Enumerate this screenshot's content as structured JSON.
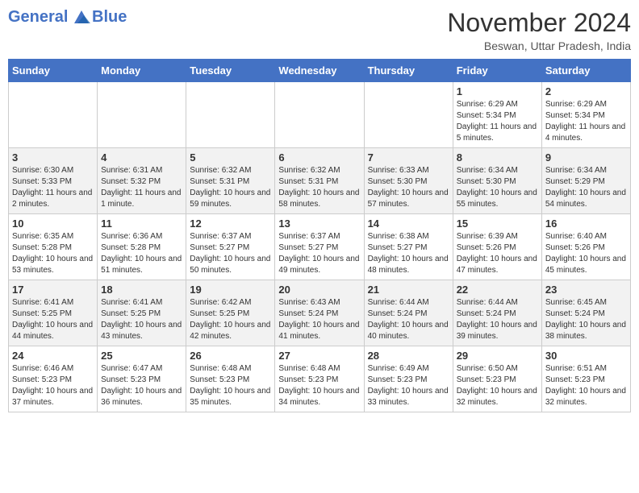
{
  "header": {
    "logo_line1": "General",
    "logo_line2": "Blue",
    "month": "November 2024",
    "location": "Beswan, Uttar Pradesh, India"
  },
  "days_of_week": [
    "Sunday",
    "Monday",
    "Tuesday",
    "Wednesday",
    "Thursday",
    "Friday",
    "Saturday"
  ],
  "weeks": [
    [
      {
        "day": "",
        "info": ""
      },
      {
        "day": "",
        "info": ""
      },
      {
        "day": "",
        "info": ""
      },
      {
        "day": "",
        "info": ""
      },
      {
        "day": "",
        "info": ""
      },
      {
        "day": "1",
        "info": "Sunrise: 6:29 AM\nSunset: 5:34 PM\nDaylight: 11 hours and 5 minutes."
      },
      {
        "day": "2",
        "info": "Sunrise: 6:29 AM\nSunset: 5:34 PM\nDaylight: 11 hours and 4 minutes."
      }
    ],
    [
      {
        "day": "3",
        "info": "Sunrise: 6:30 AM\nSunset: 5:33 PM\nDaylight: 11 hours and 2 minutes."
      },
      {
        "day": "4",
        "info": "Sunrise: 6:31 AM\nSunset: 5:32 PM\nDaylight: 11 hours and 1 minute."
      },
      {
        "day": "5",
        "info": "Sunrise: 6:32 AM\nSunset: 5:31 PM\nDaylight: 10 hours and 59 minutes."
      },
      {
        "day": "6",
        "info": "Sunrise: 6:32 AM\nSunset: 5:31 PM\nDaylight: 10 hours and 58 minutes."
      },
      {
        "day": "7",
        "info": "Sunrise: 6:33 AM\nSunset: 5:30 PM\nDaylight: 10 hours and 57 minutes."
      },
      {
        "day": "8",
        "info": "Sunrise: 6:34 AM\nSunset: 5:30 PM\nDaylight: 10 hours and 55 minutes."
      },
      {
        "day": "9",
        "info": "Sunrise: 6:34 AM\nSunset: 5:29 PM\nDaylight: 10 hours and 54 minutes."
      }
    ],
    [
      {
        "day": "10",
        "info": "Sunrise: 6:35 AM\nSunset: 5:28 PM\nDaylight: 10 hours and 53 minutes."
      },
      {
        "day": "11",
        "info": "Sunrise: 6:36 AM\nSunset: 5:28 PM\nDaylight: 10 hours and 51 minutes."
      },
      {
        "day": "12",
        "info": "Sunrise: 6:37 AM\nSunset: 5:27 PM\nDaylight: 10 hours and 50 minutes."
      },
      {
        "day": "13",
        "info": "Sunrise: 6:37 AM\nSunset: 5:27 PM\nDaylight: 10 hours and 49 minutes."
      },
      {
        "day": "14",
        "info": "Sunrise: 6:38 AM\nSunset: 5:27 PM\nDaylight: 10 hours and 48 minutes."
      },
      {
        "day": "15",
        "info": "Sunrise: 6:39 AM\nSunset: 5:26 PM\nDaylight: 10 hours and 47 minutes."
      },
      {
        "day": "16",
        "info": "Sunrise: 6:40 AM\nSunset: 5:26 PM\nDaylight: 10 hours and 45 minutes."
      }
    ],
    [
      {
        "day": "17",
        "info": "Sunrise: 6:41 AM\nSunset: 5:25 PM\nDaylight: 10 hours and 44 minutes."
      },
      {
        "day": "18",
        "info": "Sunrise: 6:41 AM\nSunset: 5:25 PM\nDaylight: 10 hours and 43 minutes."
      },
      {
        "day": "19",
        "info": "Sunrise: 6:42 AM\nSunset: 5:25 PM\nDaylight: 10 hours and 42 minutes."
      },
      {
        "day": "20",
        "info": "Sunrise: 6:43 AM\nSunset: 5:24 PM\nDaylight: 10 hours and 41 minutes."
      },
      {
        "day": "21",
        "info": "Sunrise: 6:44 AM\nSunset: 5:24 PM\nDaylight: 10 hours and 40 minutes."
      },
      {
        "day": "22",
        "info": "Sunrise: 6:44 AM\nSunset: 5:24 PM\nDaylight: 10 hours and 39 minutes."
      },
      {
        "day": "23",
        "info": "Sunrise: 6:45 AM\nSunset: 5:24 PM\nDaylight: 10 hours and 38 minutes."
      }
    ],
    [
      {
        "day": "24",
        "info": "Sunrise: 6:46 AM\nSunset: 5:23 PM\nDaylight: 10 hours and 37 minutes."
      },
      {
        "day": "25",
        "info": "Sunrise: 6:47 AM\nSunset: 5:23 PM\nDaylight: 10 hours and 36 minutes."
      },
      {
        "day": "26",
        "info": "Sunrise: 6:48 AM\nSunset: 5:23 PM\nDaylight: 10 hours and 35 minutes."
      },
      {
        "day": "27",
        "info": "Sunrise: 6:48 AM\nSunset: 5:23 PM\nDaylight: 10 hours and 34 minutes."
      },
      {
        "day": "28",
        "info": "Sunrise: 6:49 AM\nSunset: 5:23 PM\nDaylight: 10 hours and 33 minutes."
      },
      {
        "day": "29",
        "info": "Sunrise: 6:50 AM\nSunset: 5:23 PM\nDaylight: 10 hours and 32 minutes."
      },
      {
        "day": "30",
        "info": "Sunrise: 6:51 AM\nSunset: 5:23 PM\nDaylight: 10 hours and 32 minutes."
      }
    ]
  ]
}
